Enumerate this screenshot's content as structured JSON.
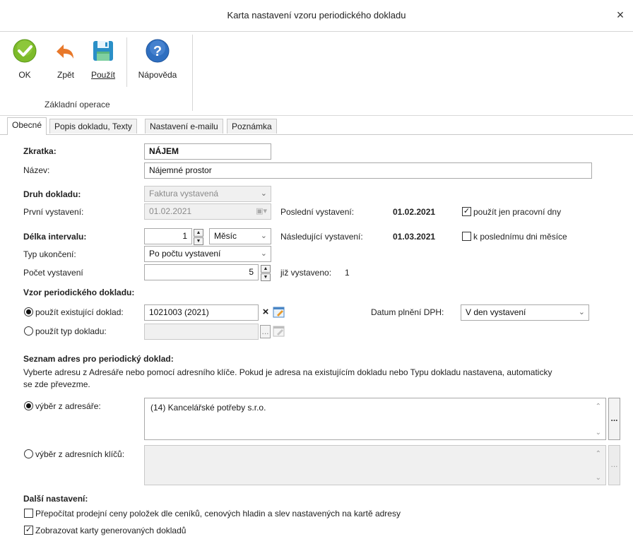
{
  "window": {
    "title": "Karta nastavení vzoru periodického dokladu",
    "close_icon": "×"
  },
  "toolbar": {
    "ok_label": "OK",
    "back_label": "Zpět",
    "apply_label": "Použít",
    "help_label": "Nápověda",
    "group_label": "Základní operace"
  },
  "tabs": [
    {
      "label": "Obecné"
    },
    {
      "label": "Popis dokladu, Texty"
    },
    {
      "label": "Nastavení e-mailu"
    },
    {
      "label": "Poznámka"
    }
  ],
  "form": {
    "zkratka_label": "Zkratka:",
    "zkratka_value": "NÁJEM",
    "nazev_label": "Název:",
    "nazev_value": "Nájemné prostor",
    "druh_label": "Druh dokladu:",
    "druh_value": "Faktura vystavená",
    "prvni_label": "První vystavení:",
    "prvni_value": "01.02.2021",
    "posledni_label": "Poslední vystavení:",
    "posledni_value": "01.02.2021",
    "pracovni_label": "použít jen pracovní dny",
    "delka_label": "Délka intervalu:",
    "delka_value": "1",
    "delka_unit": "Měsíc",
    "nasledujici_label": "Následující vystavení:",
    "nasledujici_value": "01.03.2021",
    "posledni_den_label": "k poslednímu dni měsíce",
    "typ_ukonceni_label": "Typ ukončení:",
    "typ_ukonceni_value": "Po počtu vystavení",
    "pocet_label": "Počet vystavení",
    "pocet_value": "5",
    "jiz_label": "již vystaveno:",
    "jiz_value": "1"
  },
  "vzor": {
    "heading": "Vzor periodického dokladu:",
    "existujici_label": "použít existující doklad:",
    "existujici_value": "1021003 (2021)",
    "typ_label": "použít typ dokladu:",
    "dph_label": "Datum plnění DPH:",
    "dph_value": "V den vystavení"
  },
  "adresy": {
    "heading": "Seznam adres pro periodický doklad:",
    "desc_line1": "Vyberte adresu z Adresáře nebo pomocí adresního klíče. Pokud je adresa na existujícím dokladu nebo Typu dokladu nastavena, automaticky",
    "desc_line2": "se zde převezme.",
    "adresar_label": "výběr z adresáře:",
    "adresar_value": "(14) Kancelářské potřeby s.r.o.",
    "klice_label": "výběr z adresních klíčů:",
    "dots": "..."
  },
  "dalsi": {
    "heading": "Další nastavení:",
    "prepocitat_label": "Přepočítat prodejní ceny položek dle ceníků, cenových hladin a slev nastavených na kartě adresy",
    "zobrazovat_label": "Zobrazovat karty generovaných dokladů"
  }
}
